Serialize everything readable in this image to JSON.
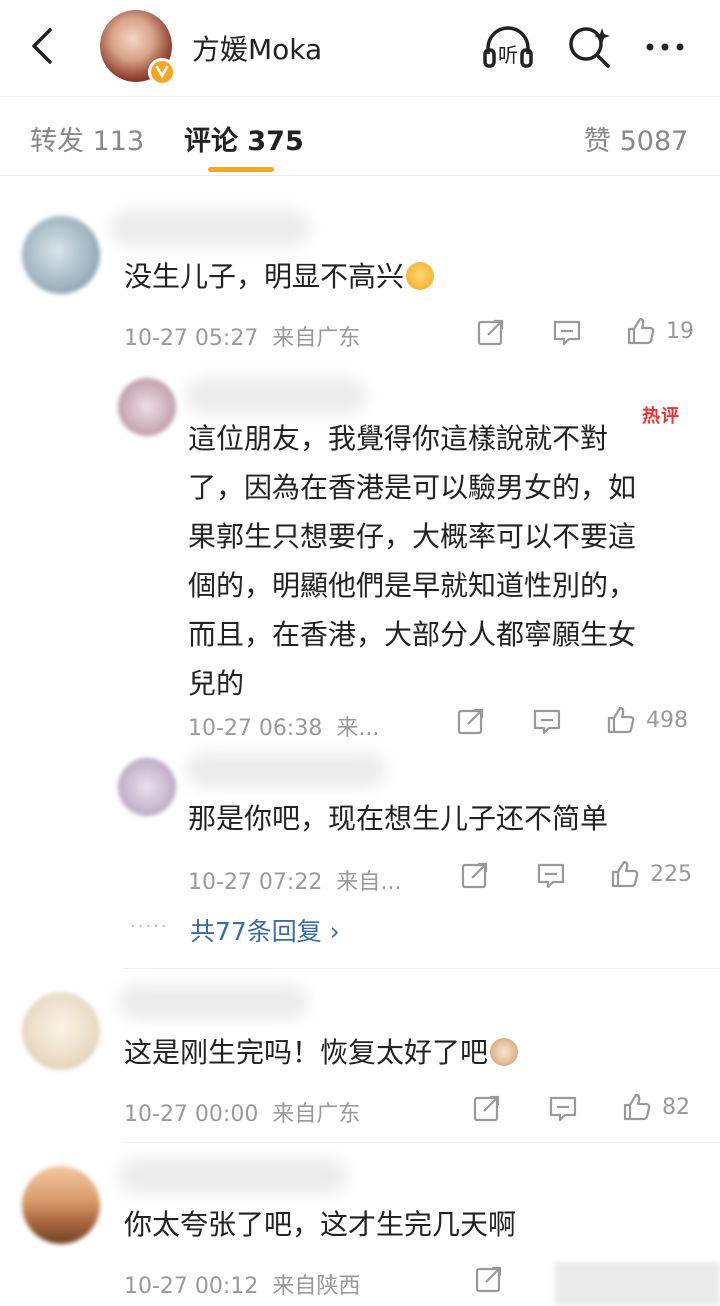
{
  "header": {
    "title": "方媛Moka",
    "listen_label": "听"
  },
  "tabs": [
    {
      "label": "转发 113"
    },
    {
      "label": "评论 375"
    },
    {
      "label": "赞 5087"
    }
  ],
  "comments": [
    {
      "text": "没生儿子，明显不高兴",
      "time": "10-27 05:27",
      "location": "来自广东",
      "likes": "19"
    },
    {
      "hot_badge": "热评",
      "text_lines": [
        "這位朋友，我覺得你這樣說就不對",
        "了，因為在香港是可以驗男女的，如",
        "果郭生只想要仔，大概率可以不要這",
        "個的，明顯他們是早就知道性別的，",
        "而且，在香港，大部分人都寧願生女",
        "兒的"
      ],
      "time": "10-27 06:38",
      "location": "来...",
      "likes": "498"
    },
    {
      "text": "那是你吧，现在想生儿子还不简单",
      "time": "10-27 07:22",
      "location": "来自...",
      "likes": "225"
    },
    {
      "text": "这是刚生完吗！恢复太好了吧",
      "time": "10-27 00:00",
      "location": "来自广东",
      "likes": "82"
    },
    {
      "text": "你太夸张了吧，这才生完几天啊",
      "time": "10-27 00:12",
      "location": "来自陕西"
    }
  ],
  "more_replies": "共77条回复 ›",
  "colors": {
    "accent": "#f6a623",
    "link": "#3b6aa8",
    "hot": "#e33333"
  }
}
